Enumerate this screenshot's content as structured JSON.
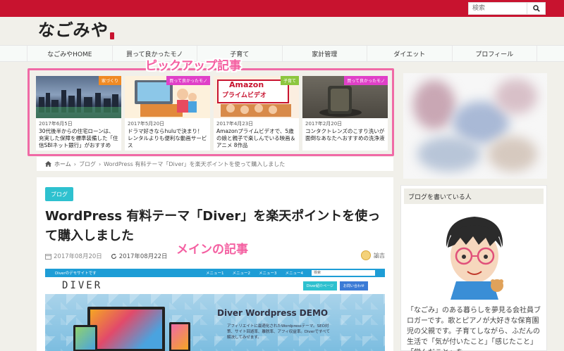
{
  "search": {
    "placeholder": "検索"
  },
  "logo": {
    "text": "なごみや"
  },
  "nav": {
    "items": [
      {
        "label": "なごみやHOME"
      },
      {
        "label": "買って良かったモノ"
      },
      {
        "label": "子育て"
      },
      {
        "label": "家計管理"
      },
      {
        "label": "ダイエット"
      },
      {
        "label": "プロフィール"
      }
    ]
  },
  "annotations": {
    "pickup": "ピックアップ記事",
    "main": "メインの記事"
  },
  "pickup": {
    "cards": [
      {
        "badge": "家づくり",
        "badge_color": "#f08a24",
        "date": "2017年6月5日",
        "title": "30代後半からの住宅ローンは、充実した保障を標準装備した「住信SBIネット銀行」がおすすめ"
      },
      {
        "badge": "買って良かったモノ",
        "badge_color": "#e040c8",
        "date": "2017年5月20日",
        "title": "ドラマ好きならhuluで決まり！レンタルよりも便利な動画サービス"
      },
      {
        "badge": "子育て",
        "badge_color": "#8cc63e",
        "date": "2017年4月23日",
        "title": "Amazonプライムビデオで、5歳の娘と親子で楽しんでいる映画＆アニメ 8作品",
        "img_text_1": "Amazon",
        "img_text_2": "プライムビデオ"
      },
      {
        "badge": "買って良かったモノ",
        "badge_color": "#e040c8",
        "date": "2017年2月20日",
        "title": "コンタクトレンズのこすり洗いが面倒なあなたへおすすめの洗浄液"
      }
    ]
  },
  "breadcrumb": {
    "home": "ホーム",
    "sep": "›",
    "category": "ブログ",
    "current": "WordPress 有料テーマ「Diver」を楽天ポイントを使って購入しました"
  },
  "article": {
    "category": "ブログ",
    "title": "WordPress 有料テーマ「Diver」を楽天ポイントを使って購入しました",
    "published": "2017年08月20日",
    "updated": "2017年08月22日",
    "author": "諭吉"
  },
  "demo": {
    "site_label": "Diverのデモサイトです",
    "menu1": "メニュー1",
    "menu2": "メニュー2",
    "menu3": "メニュー3",
    "menu4": "メニュー4",
    "search": "検索",
    "logo": "DIVER",
    "btn1": "Diver紹介ページ",
    "btn2": "お問い合わせ",
    "hero_title": "Diver Wordpress DEMO",
    "hero_sub": "アフィリエイトに最適化されたWordpressテーマ。SEO対策、サイト回遊率、離脱率、アフィ収益率。Diverですべて解決してみせます。"
  },
  "sidebar": {
    "heading": "ブログを書いている人",
    "intro": "「なごみ」のある暮らしを夢見る会社員ブロガーです。歌とピアノが大好きな保育園児の父親です。子育てしながら、ふだんの生活で「気が付いたこと」「感じたこと」「学んだこと」を"
  }
}
